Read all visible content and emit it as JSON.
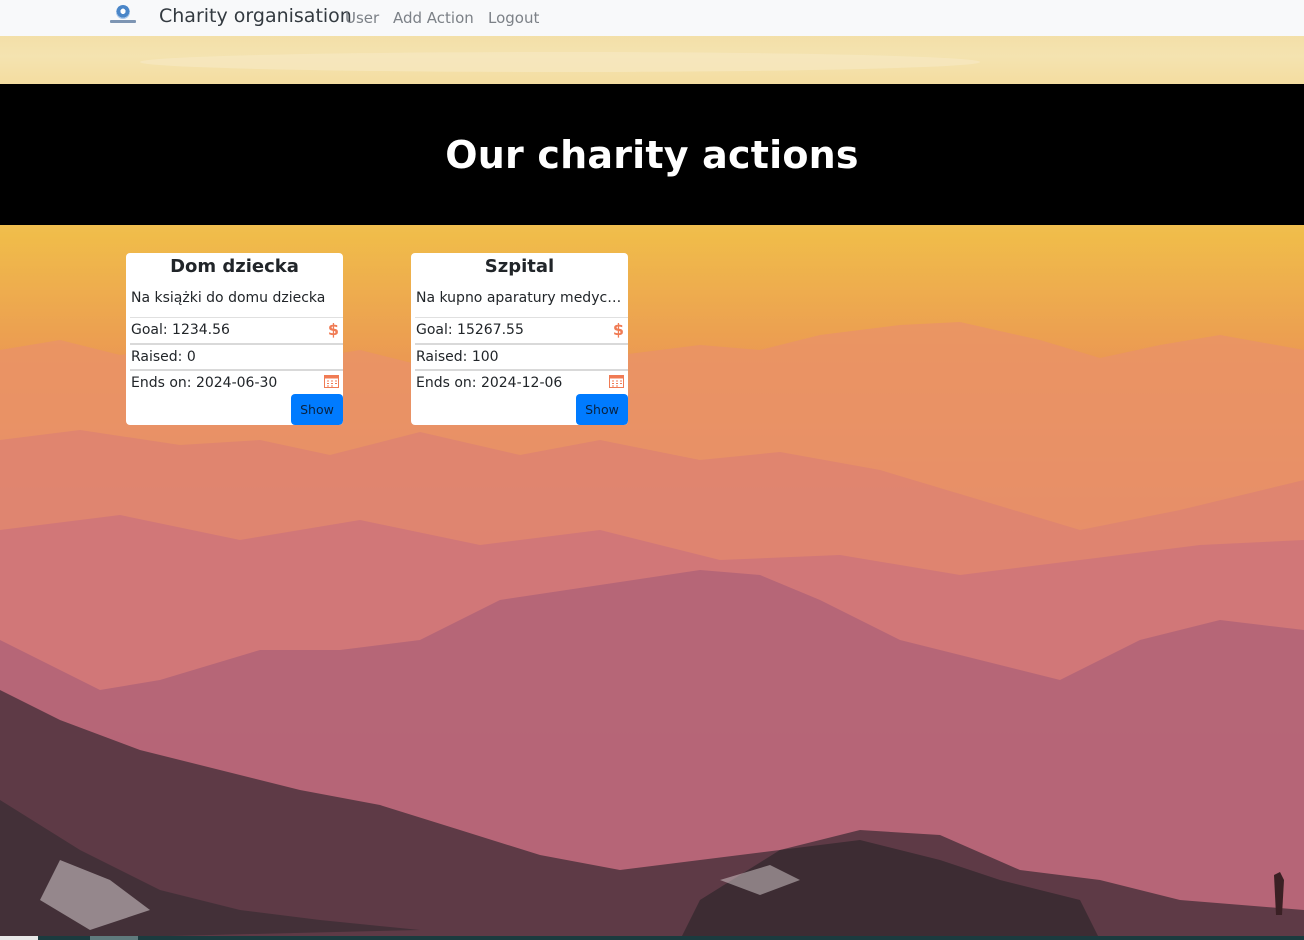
{
  "navbar": {
    "brand": "Charity organisation",
    "links": [
      "User",
      "Add Action",
      "Logout"
    ],
    "logo_icon": "charity-logo"
  },
  "hero": {
    "title": "Our charity actions"
  },
  "cards": [
    {
      "title": "Dom dziecka",
      "description": "Na książki do domu dziecka",
      "goal": "Goal: 1234.56",
      "raised": "Raised: 0",
      "ends": "Ends on: 2024-06-30",
      "button": "Show"
    },
    {
      "title": "Szpital",
      "description": "Na kupno aparatury medycznej",
      "goal": "Goal: 15267.55",
      "raised": "Raised: 100",
      "ends": "Ends on: 2024-12-06",
      "button": "Show"
    }
  ],
  "icons": {
    "goal": "dollar-icon",
    "ends": "calendar-icon"
  },
  "colors": {
    "accent_icon": "#f07b54",
    "button": "#007bff",
    "hero_bg": "#000000",
    "navbar_bg": "#f8f9fa"
  }
}
